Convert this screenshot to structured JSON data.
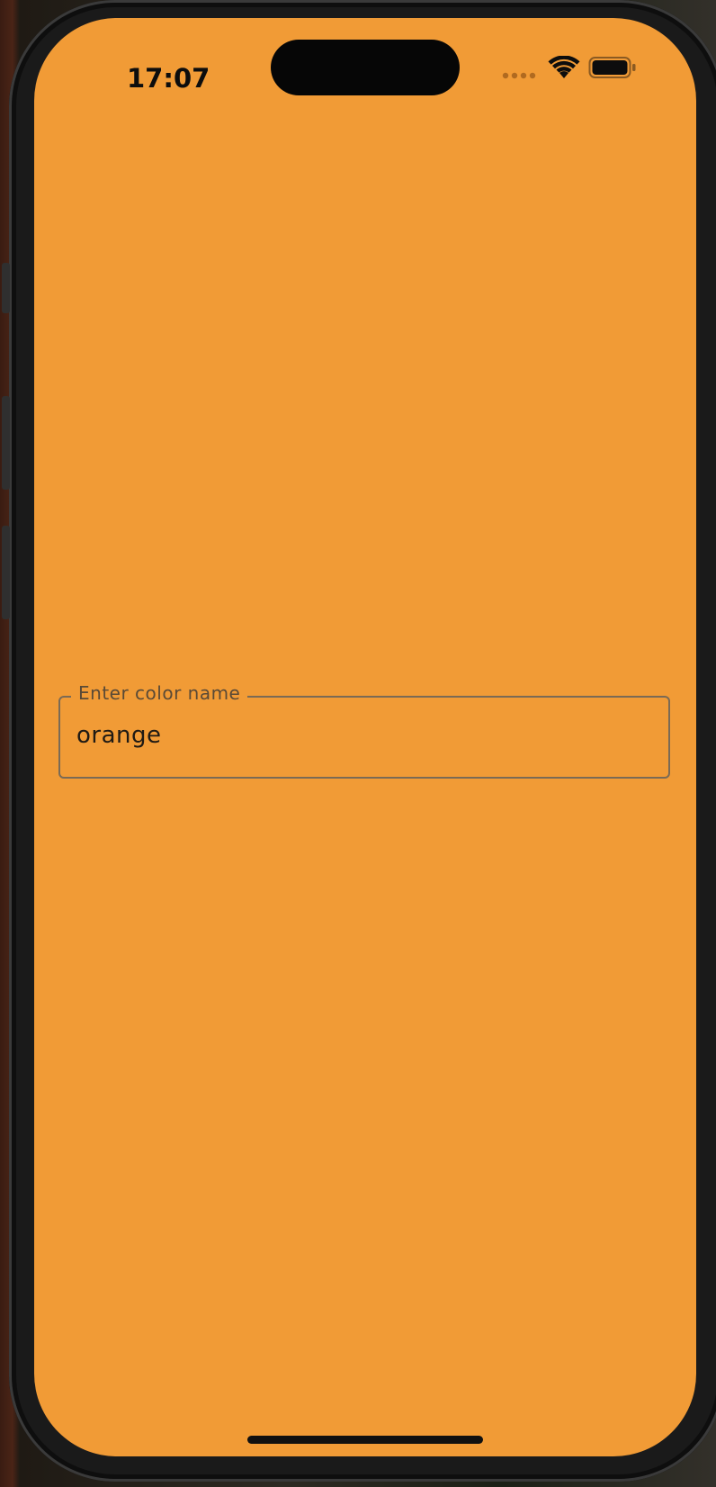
{
  "status_bar": {
    "time": "17:07",
    "icons": [
      "cellular-signal-icon",
      "wifi-icon",
      "battery-icon"
    ]
  },
  "form": {
    "color_field": {
      "label": "Enter color name",
      "value": "orange"
    }
  },
  "colors": {
    "background": "#f19b36",
    "text": "#1f1a14",
    "border": "#7a6a55"
  }
}
